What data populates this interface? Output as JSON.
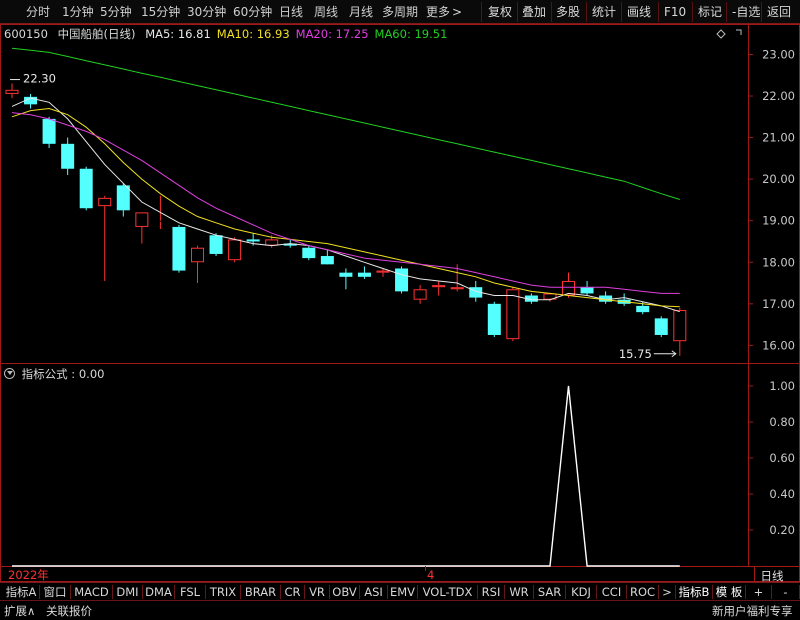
{
  "toolbar": {
    "periods": [
      "分时",
      "1分钟",
      "5分钟",
      "15分钟",
      "30分钟",
      "60分钟",
      "日线",
      "周线",
      "月线",
      "多周期",
      "更多"
    ],
    "active_period": "日线",
    "more_arrow": ">",
    "tools": [
      "复权",
      "叠加",
      "多股",
      "统计",
      "画线",
      "F10",
      "标记",
      "-自选",
      "返回"
    ]
  },
  "stock": {
    "code": "600150",
    "name": "中国船舶(日线)"
  },
  "ma_legend": [
    {
      "label": "MA5: 16.81",
      "color": "#e8e8e8"
    },
    {
      "label": "MA10: 16.93",
      "color": "#f0e020"
    },
    {
      "label": "MA20: 17.25",
      "color": "#e040e0"
    },
    {
      "label": "MA60: 19.51",
      "color": "#20d020"
    }
  ],
  "indicator_legend": {
    "icon": "settings-circle-icon",
    "label": "指标公式 : 0.00"
  },
  "annotations": {
    "high_label": "22.30",
    "low_label": "15.75"
  },
  "x_axis": {
    "year_label": "2022年",
    "month_label": "4",
    "period_label": "日线"
  },
  "tabs": [
    "指标A",
    "窗口",
    "MACD",
    "DMI",
    "DMA",
    "FSL",
    "TRIX",
    "BRAR",
    "CR",
    "VR",
    "OBV",
    "ASI",
    "EMV",
    "VOL-TDX",
    "RSI",
    "WR",
    "SAR",
    "KDJ",
    "CCI",
    "ROC",
    ">",
    "指标B",
    "模 板",
    "+",
    "-"
  ],
  "statusbar": {
    "expand": "扩展∧",
    "related": "关联报价",
    "promo": "新用户福利专享"
  },
  "colors": {
    "up": "#ff3232",
    "down": "#54ffff",
    "frame": "#a01818",
    "axis_text": "#c8c8c8"
  },
  "chart_data": [
    {
      "type": "candlestick",
      "title": "",
      "ylim": [
        15.6,
        23.3
      ],
      "y_ticks": [
        16.0,
        17.0,
        18.0,
        19.0,
        20.0,
        21.0,
        22.0,
        23.0
      ],
      "ohlc": [
        {
          "o": 22.05,
          "h": 22.3,
          "l": 21.95,
          "c": 22.15
        },
        {
          "o": 21.98,
          "h": 22.05,
          "l": 21.7,
          "c": 21.8
        },
        {
          "o": 21.45,
          "h": 21.5,
          "l": 20.75,
          "c": 20.85
        },
        {
          "o": 20.85,
          "h": 21.0,
          "l": 20.1,
          "c": 20.25
        },
        {
          "o": 20.25,
          "h": 20.3,
          "l": 19.25,
          "c": 19.3
        },
        {
          "o": 19.35,
          "h": 19.6,
          "l": 17.55,
          "c": 19.55
        },
        {
          "o": 19.85,
          "h": 19.9,
          "l": 19.1,
          "c": 19.25
        },
        {
          "o": 18.85,
          "h": 19.2,
          "l": 18.45,
          "c": 19.2
        },
        {
          "o": 19.0,
          "h": 19.6,
          "l": 18.8,
          "c": 19.0
        },
        {
          "o": 18.85,
          "h": 18.9,
          "l": 17.75,
          "c": 17.8
        },
        {
          "o": 18.0,
          "h": 18.4,
          "l": 17.5,
          "c": 18.35
        },
        {
          "o": 18.65,
          "h": 18.7,
          "l": 18.15,
          "c": 18.2
        },
        {
          "o": 18.05,
          "h": 18.6,
          "l": 18.0,
          "c": 18.55
        },
        {
          "o": 18.55,
          "h": 18.7,
          "l": 18.4,
          "c": 18.5
        },
        {
          "o": 18.4,
          "h": 18.65,
          "l": 18.35,
          "c": 18.55
        },
        {
          "o": 18.45,
          "h": 18.55,
          "l": 18.35,
          "c": 18.4
        },
        {
          "o": 18.35,
          "h": 18.4,
          "l": 18.05,
          "c": 18.1
        },
        {
          "o": 18.15,
          "h": 18.3,
          "l": 17.95,
          "c": 17.95
        },
        {
          "o": 17.75,
          "h": 17.85,
          "l": 17.35,
          "c": 17.65
        },
        {
          "o": 17.75,
          "h": 17.9,
          "l": 17.6,
          "c": 17.65
        },
        {
          "o": 17.75,
          "h": 17.85,
          "l": 17.65,
          "c": 17.8
        },
        {
          "o": 17.85,
          "h": 17.9,
          "l": 17.25,
          "c": 17.3
        },
        {
          "o": 17.1,
          "h": 17.45,
          "l": 17.0,
          "c": 17.35
        },
        {
          "o": 17.4,
          "h": 17.55,
          "l": 17.2,
          "c": 17.45
        },
        {
          "o": 17.35,
          "h": 17.95,
          "l": 17.3,
          "c": 17.4
        },
        {
          "o": 17.4,
          "h": 17.55,
          "l": 17.05,
          "c": 17.15
        },
        {
          "o": 17.0,
          "h": 17.05,
          "l": 16.2,
          "c": 16.25
        },
        {
          "o": 16.15,
          "h": 17.4,
          "l": 16.1,
          "c": 17.35
        },
        {
          "o": 17.2,
          "h": 17.25,
          "l": 17.0,
          "c": 17.05
        },
        {
          "o": 17.1,
          "h": 17.25,
          "l": 17.05,
          "c": 17.25
        },
        {
          "o": 17.2,
          "h": 17.75,
          "l": 17.15,
          "c": 17.55
        },
        {
          "o": 17.4,
          "h": 17.55,
          "l": 17.2,
          "c": 17.25
        },
        {
          "o": 17.2,
          "h": 17.3,
          "l": 17.0,
          "c": 17.05
        },
        {
          "o": 17.1,
          "h": 17.25,
          "l": 16.95,
          "c": 17.0
        },
        {
          "o": 16.95,
          "h": 17.05,
          "l": 16.75,
          "c": 16.8
        },
        {
          "o": 16.65,
          "h": 16.7,
          "l": 16.2,
          "c": 16.25
        },
        {
          "o": 16.1,
          "h": 16.9,
          "l": 15.75,
          "c": 16.85
        }
      ],
      "series": [
        {
          "name": "MA5",
          "color": "#e8e8e8",
          "values": [
            21.75,
            21.95,
            21.85,
            21.45,
            20.9,
            20.35,
            19.9,
            19.45,
            19.2,
            18.95,
            18.8,
            18.65,
            18.55,
            18.45,
            18.4,
            18.45,
            18.4,
            18.3,
            18.15,
            18.0,
            17.85,
            17.7,
            17.6,
            17.55,
            17.5,
            17.3,
            17.2,
            17.2,
            17.1,
            17.1,
            17.25,
            17.2,
            17.1,
            17.15,
            17.05,
            16.95,
            16.81
          ]
        },
        {
          "name": "MA10",
          "color": "#f0e020",
          "values": [
            21.5,
            21.65,
            21.7,
            21.55,
            21.25,
            20.85,
            20.4,
            20.0,
            19.65,
            19.35,
            19.1,
            18.95,
            18.8,
            18.7,
            18.6,
            18.55,
            18.5,
            18.45,
            18.35,
            18.25,
            18.15,
            18.05,
            17.95,
            17.85,
            17.75,
            17.65,
            17.5,
            17.4,
            17.3,
            17.25,
            17.2,
            17.15,
            17.1,
            17.05,
            17.0,
            16.95,
            16.93
          ]
        },
        {
          "name": "MA20",
          "color": "#e040e0",
          "values": [
            21.6,
            21.55,
            21.45,
            21.3,
            21.15,
            20.95,
            20.7,
            20.45,
            20.15,
            19.85,
            19.55,
            19.3,
            19.1,
            18.9,
            18.7,
            18.55,
            18.4,
            18.3,
            18.2,
            18.1,
            18.05,
            18.0,
            17.95,
            17.9,
            17.85,
            17.75,
            17.65,
            17.55,
            17.45,
            17.4,
            17.4,
            17.4,
            17.4,
            17.35,
            17.3,
            17.25,
            17.25
          ]
        },
        {
          "name": "MA60",
          "color": "#20d020",
          "values": [
            23.15,
            23.1,
            23.05,
            22.95,
            22.85,
            22.75,
            22.65,
            22.55,
            22.45,
            22.35,
            22.25,
            22.15,
            22.05,
            21.95,
            21.85,
            21.75,
            21.65,
            21.55,
            21.45,
            21.35,
            21.25,
            21.15,
            21.05,
            20.95,
            20.85,
            20.75,
            20.65,
            20.55,
            20.45,
            20.35,
            20.25,
            20.15,
            20.05,
            19.95,
            19.8,
            19.65,
            19.51
          ]
        }
      ]
    },
    {
      "type": "line",
      "title": "",
      "ylim": [
        0,
        1.1
      ],
      "y_ticks": [
        0.2,
        0.4,
        0.6,
        0.8,
        1.0
      ],
      "series": [
        {
          "name": "",
          "color": "#ffffff",
          "values": [
            0,
            0,
            0,
            0,
            0,
            0,
            0,
            0,
            0,
            0,
            0,
            0,
            0,
            0,
            0,
            0,
            0,
            0,
            0,
            0,
            0,
            0,
            0,
            0,
            0,
            0,
            0,
            0,
            0,
            0,
            1,
            0,
            0,
            0,
            0,
            0,
            0
          ]
        }
      ]
    }
  ]
}
